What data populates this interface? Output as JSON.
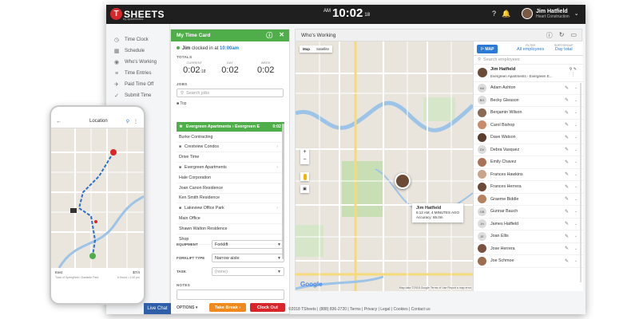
{
  "header": {
    "logo_letter": "T",
    "logo_text": "SHEETS",
    "logo_sub": "by quickbooks",
    "ampm": "AM",
    "time": "10:02",
    "seconds": "18",
    "user_name": "Jim Hatfield",
    "user_company": "Heart Construction"
  },
  "sidebar": {
    "items": [
      {
        "label": "Time Clock",
        "icon": "clock-icon"
      },
      {
        "label": "Schedule",
        "icon": "calendar-icon"
      },
      {
        "label": "Who's Working",
        "icon": "location-icon"
      },
      {
        "label": "Time Entries",
        "icon": "entries-icon"
      },
      {
        "label": "Paid Time Off",
        "icon": "plane-icon"
      },
      {
        "label": "Submit Time",
        "icon": "submit-icon"
      }
    ]
  },
  "timecard": {
    "title": "My Time Card",
    "clocked_name": "Jim",
    "clocked_text": "clocked in at",
    "clocked_time": "10:00am",
    "totals_label": "TOTALS",
    "totals": [
      {
        "label": "CURRENT",
        "value": "0:02",
        "suffix": ":18"
      },
      {
        "label": "DAY",
        "value": "0:02",
        "suffix": ""
      },
      {
        "label": "WEEK",
        "value": "0:02",
        "suffix": ""
      }
    ],
    "jobs_label": "JOBS",
    "search_placeholder": "Search jobs",
    "top_label": "Top",
    "jobs": [
      {
        "name": "Evergreen Apartments › Evergreen E",
        "time": "0:02",
        "active": true
      },
      {
        "name": "Burke Contracting"
      },
      {
        "name": "Crestview Condos",
        "folder": true
      },
      {
        "name": "Drive Time"
      },
      {
        "name": "Evergreen Apartments",
        "folder": true
      },
      {
        "name": "Hale Corporation"
      },
      {
        "name": "Joan Canon Residence"
      },
      {
        "name": "Ken Smith Residence"
      },
      {
        "name": "Lakeview Office Park",
        "folder": true
      },
      {
        "name": "Main Office"
      },
      {
        "name": "Shawn Walton Residence"
      },
      {
        "name": "Shop"
      }
    ],
    "equipment_label": "EQUIPMENT",
    "equipment_value": "Forklift",
    "forklift_type_label": "FORKLIFT TYPE",
    "forklift_type_value": "Narrow aisle",
    "task_label": "TASK",
    "task_value": "(none)",
    "notes_label": "NOTES",
    "options_label": "OPTIONS",
    "take_break_label": "Take Break ›",
    "clock_out_label": "Clock Out"
  },
  "whos_working": {
    "title": "Who's Working",
    "map_tab_map": "Map",
    "map_tab_satellite": "Satellite",
    "map_button": "MAP",
    "filter_label": "FILTER",
    "filter_value": "All employees",
    "sort_label": "SORT/GROUP",
    "sort_value": "Day total",
    "search_placeholder": "Search employees",
    "pin_name": "Jim Hatfield",
    "pin_time": "6:12 AM, 4 MINUTES AGO",
    "pin_accuracy": "Accuracy: 65.0m",
    "google": "Google",
    "map_footer": "Map data ©2018 Google  Terms of Use  Report a map error",
    "first_employee": {
      "name": "Jim Hatfield",
      "job": "Evergreen Apartments › Evergreen E..."
    },
    "employees": [
      {
        "name": "Adam Ashton",
        "initials": "AA",
        "photo": false
      },
      {
        "name": "Becky Gleason",
        "initials": "BG",
        "photo": false
      },
      {
        "name": "Benjamin Wilson",
        "initials": "",
        "photo": true,
        "color": "#8a6a52"
      },
      {
        "name": "Carol Bishop",
        "initials": "",
        "photo": true,
        "color": "#c98b6b"
      },
      {
        "name": "Dave Watson",
        "initials": "",
        "photo": true,
        "color": "#5b3d2e"
      },
      {
        "name": "Debra Vasquez",
        "initials": "DV",
        "photo": false
      },
      {
        "name": "Emily Chavez",
        "initials": "",
        "photo": true,
        "color": "#a87358"
      },
      {
        "name": "Frances Hawkins",
        "initials": "",
        "photo": true,
        "color": "#caa48a"
      },
      {
        "name": "Frances Herrera",
        "initials": "",
        "photo": true,
        "color": "#6d4a38"
      },
      {
        "name": "Graeme Biddle",
        "initials": "",
        "photo": true,
        "color": "#b5835f"
      },
      {
        "name": "Gunnar Bauch",
        "initials": "GB",
        "photo": false
      },
      {
        "name": "James Hatfield",
        "initials": "JH",
        "photo": false
      },
      {
        "name": "Joan Ellis",
        "initials": "JE",
        "photo": false
      },
      {
        "name": "Jose Herrera",
        "initials": "",
        "photo": true,
        "color": "#7a5240"
      },
      {
        "name": "Joe Schmoe",
        "initials": "",
        "photo": true,
        "color": "#9c6d4f"
      }
    ]
  },
  "footer": {
    "links": [
      "©2018 TSheets",
      "(888) 836-2720",
      "Terms",
      "Privacy",
      "Legal",
      "Cookies",
      "Contact us"
    ]
  },
  "phone": {
    "title": "Location",
    "foot_left": "East",
    "foot_right": "$7/4",
    "foot_left2": "Town of Springfield • Eastside Park",
    "foot_right2": "8 Hours • 2:30 pm"
  },
  "livechat": "Live Chat",
  "colors": {
    "brand_green": "#4fae4a",
    "brand_red": "#d9262b",
    "brand_orange": "#f08a1c",
    "link_blue": "#2b7bd6",
    "topbar": "#1f1f1f"
  }
}
